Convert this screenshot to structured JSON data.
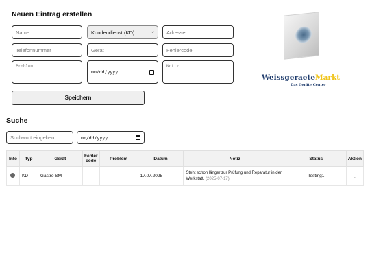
{
  "form": {
    "title": "Neuen Eintrag erstellen",
    "name_placeholder": "Name",
    "type_selected": "Kundendienst (KD)",
    "address_placeholder": "Adresse",
    "phone_placeholder": "Telefonnummer",
    "device_placeholder": "Gerät",
    "error_code_placeholder": "Fehlercode",
    "problem_placeholder": "Problem",
    "date_placeholder": "mm/dd/yyyy",
    "note_placeholder": "Notiz",
    "save_label": "Speichern"
  },
  "logo": {
    "name_part1": "Weissgeraete",
    "name_part2": "Markt",
    "tagline": "Das Geräte Center"
  },
  "search": {
    "title": "Suche",
    "keyword_placeholder": "Suchwort eingeben",
    "date_placeholder": "mm/dd/yyyy"
  },
  "table": {
    "headers": [
      "Info",
      "Typ",
      "Gerät",
      "Fehler code",
      "Problem",
      "Datum",
      "Notiz",
      "Status",
      "Aktion"
    ],
    "rows": [
      {
        "type": "KD",
        "device": "Gastro SM",
        "error_code": "",
        "problem": "",
        "date": "17.07.2025",
        "note": "Steht schon länger zur Prüfung und Reparatur in der Werkstatt.",
        "note_date": "(2025-07-17)",
        "status": "Testing1"
      }
    ]
  },
  "colors": {
    "logo_blue": "#1d3a6b",
    "logo_yellow": "#f0c419",
    "header_bg": "#f2f2f2"
  }
}
